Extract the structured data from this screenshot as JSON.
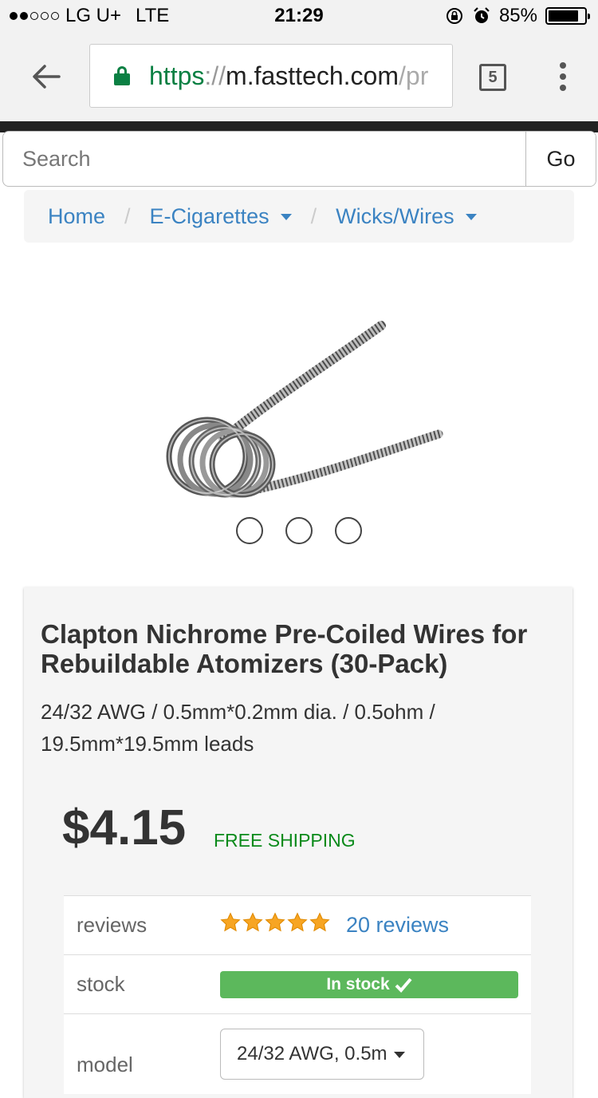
{
  "status_bar": {
    "carrier": "LG U+",
    "network": "LTE",
    "time": "21:29",
    "battery": "85%",
    "battery_level": 0.85
  },
  "browser": {
    "url_scheme": "https",
    "url_sep": "://",
    "url_host": "m.fasttech.com",
    "url_path": "/pr",
    "tab_count": "5"
  },
  "search": {
    "placeholder": "Search",
    "go_label": "Go"
  },
  "breadcrumb": {
    "items": [
      {
        "label": "Home"
      },
      {
        "label": "E-Cigarettes"
      },
      {
        "label": "Wicks/Wires"
      }
    ]
  },
  "product": {
    "title": "Clapton Nichrome Pre-Coiled Wires for Rebuildable Atomizers (30-Pack)",
    "subtitle": "24/32 AWG / 0.5mm*0.2mm dia. / 0.5ohm / 19.5mm*19.5mm leads",
    "price": "$4.15",
    "shipping": "FREE SHIPPING",
    "rating": 5,
    "specs": {
      "reviews_label": "reviews",
      "reviews_link": "20 reviews",
      "stock_label": "stock",
      "stock_value": "In stock",
      "model_label": "model",
      "model_value": "24/32 AWG, 0.5m"
    }
  },
  "colors": {
    "link": "#3b83c2",
    "green": "#5cb85c",
    "ship_green": "#0a8a1a",
    "secure_green": "#0b8043"
  }
}
